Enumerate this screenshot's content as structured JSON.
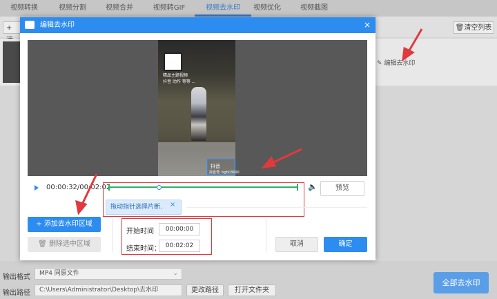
{
  "top_tabs": [
    "视频转换",
    "视频分割",
    "视频合并",
    "视频转GIF",
    "视频去水印",
    "视频优化",
    "视频截图"
  ],
  "toolbar": {
    "add_label": "+ 添",
    "clear_label": "清空列表"
  },
  "list": {
    "edit_label": "编辑去水印"
  },
  "dialog": {
    "title": "编辑去水印",
    "close": "×",
    "video": {
      "overlay_top": "精品主题视频",
      "overlay_mid": "抖音  动作   等等  ...",
      "watermark_logo": "抖音",
      "watermark_id": "抖音号: hgh03600"
    },
    "time_display": "00:00:32/00:02:02",
    "tooltip": "拖动指针选择片断.",
    "tooltip_close": "×",
    "preview_label": "预览",
    "add_region_label": "+ 添加去水印区域",
    "delete_region_label": "删除选中区域",
    "start_label": "开始时间",
    "start_value": "00:00:00",
    "end_label": "结束时间：",
    "end_value": "00:02:02",
    "cancel_label": "取消",
    "ok_label": "确定",
    "progress": 0.262
  },
  "output": {
    "format_label": "输出格式",
    "format_value": "MP4  同原文件",
    "path_label": "输出路径",
    "path_value": "C:\\Users\\Administrator\\Desktop\\去水印",
    "change_path_label": "更改路径",
    "open_folder_label": "打开文件夹",
    "all_remove_label": "全部去水印"
  },
  "colors": {
    "accent": "#2d8cf0",
    "highlight": "#e0393e",
    "track": "#28b464"
  }
}
